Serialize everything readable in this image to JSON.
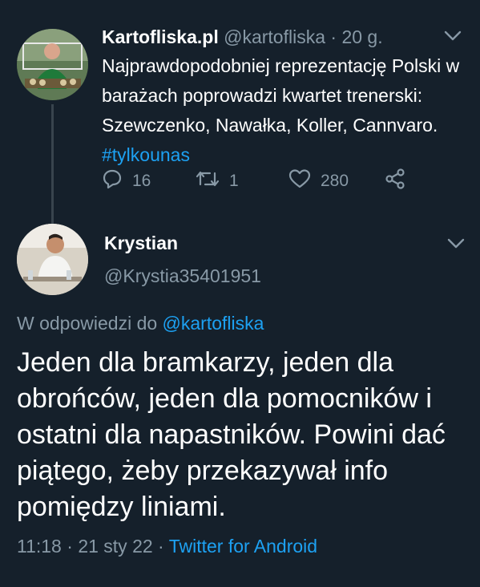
{
  "tweet1": {
    "name": "Kartofliska.pl",
    "handle": "@kartofliska",
    "separator": "·",
    "time": "20 g.",
    "text_main": "Najprawdopodobniej reprezentację Polski w barażach poprowadzi kwartet trenerski: Szewczenko, Nawałka, Koller, Cannvaro.",
    "hashtag": "#tylkounas",
    "reply_count": "16",
    "retweet_count": "1",
    "like_count": "280"
  },
  "tweet2": {
    "name": "Krystian",
    "handle": "@Krystia35401951",
    "reply_prefix": "W odpowiedzi do",
    "reply_handle": "@kartofliska",
    "text": "Jeden dla bramkarzy, jeden dla obrońców, jeden dla pomocników i ostatni dla napastników. Powini dać piątego, żeby przekazywał info pomiędzy liniami.",
    "time": "11:18",
    "date": "21 sty 22",
    "separator": "·",
    "source": "Twitter for Android"
  },
  "colors": {
    "background": "#15202b",
    "text": "#ffffff",
    "muted": "#8899a6",
    "link": "#1da1f2",
    "thread_line": "#38444d"
  },
  "icons": [
    "chevron-down-icon",
    "reply-icon",
    "retweet-icon",
    "like-icon",
    "share-icon"
  ]
}
